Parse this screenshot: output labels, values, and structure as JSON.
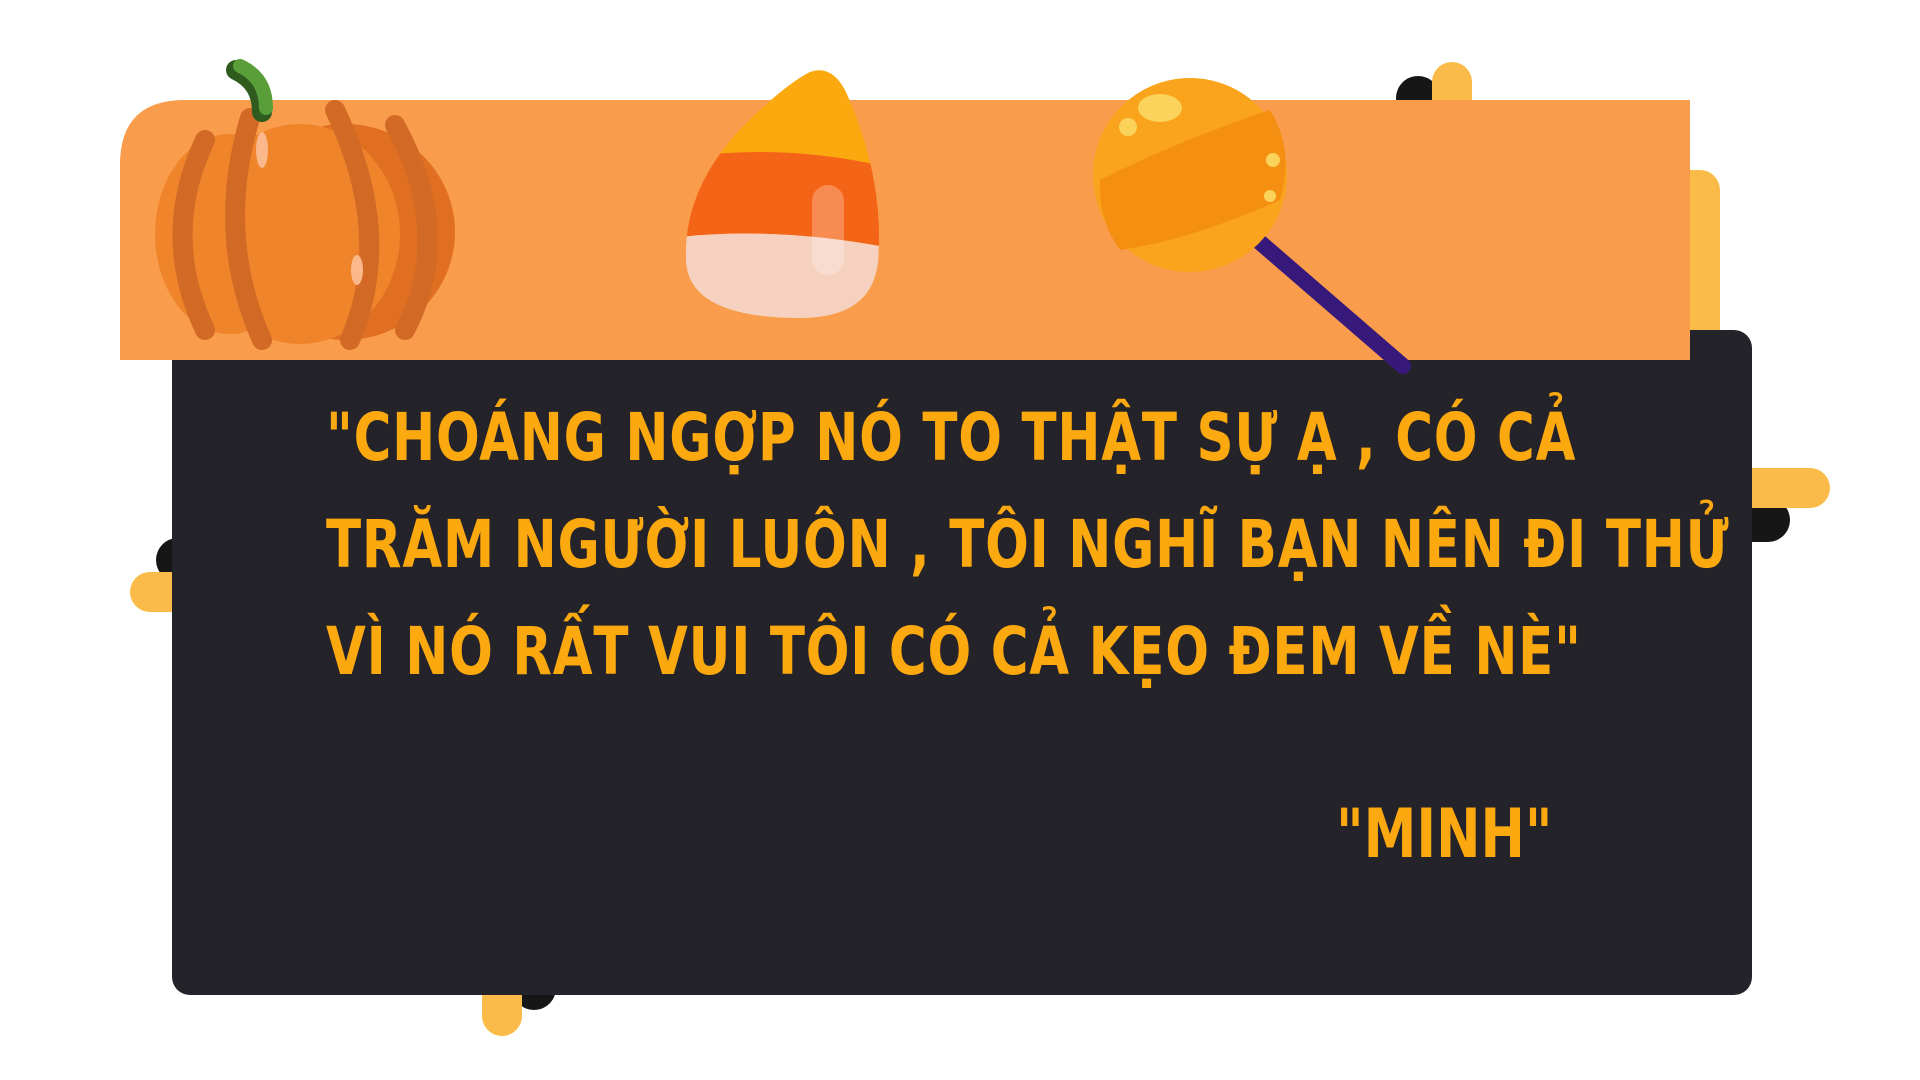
{
  "quote": {
    "lines": [
      "\"CHOÁNG NGỢP NÓ TO THẬT SỰ Ạ , CÓ CẢ",
      "TRĂM NGƯỜI LUÔN , TÔI NGHĨ BẠN NÊN ĐI THỬ",
      "VÌ NÓ RẤT VUI TÔI CÓ CẢ KẸO ĐEM VỀ NÈ\""
    ]
  },
  "author": "\"MINH\"",
  "colors": {
    "banner": "#f99c4c",
    "panel": "#24232a",
    "text": "#fca80f",
    "frame_yellow": "#fbbb48",
    "frame_shadow": "#161617",
    "pumpkin": "#f0842a",
    "pumpkin_stripe": "#d26a26",
    "stem": "#5a9e3a",
    "candy_top": "#fca80f",
    "candy_mid": "#f46417",
    "candy_bottom": "#f6d1c0",
    "lollipop": "#fca418",
    "lollipop_stick": "#36197a"
  },
  "icons": [
    "pumpkin-icon",
    "candy-corn-icon",
    "lollipop-icon"
  ]
}
